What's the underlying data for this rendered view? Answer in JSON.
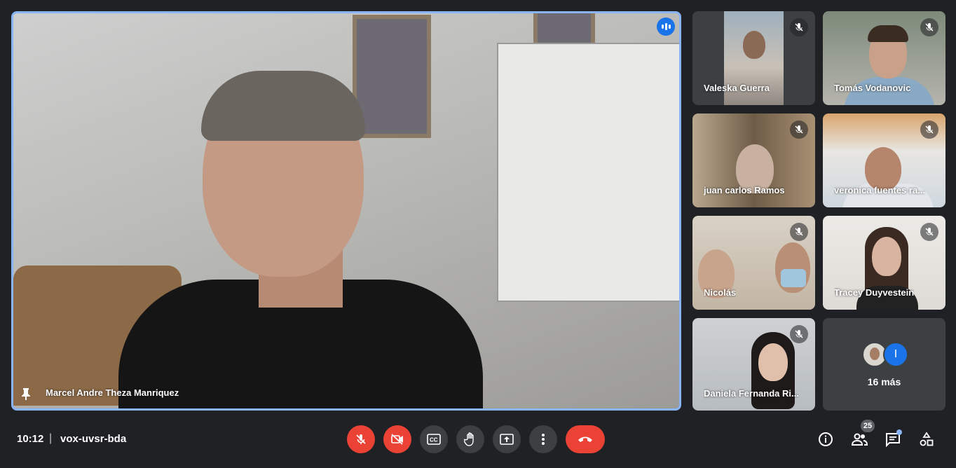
{
  "main_speaker": {
    "name": "Marcel Andre Theza Manriquez"
  },
  "participants": [
    {
      "name": "Valeska Guerra"
    },
    {
      "name": "Tomás Vodanovic"
    },
    {
      "name": "juan carlos Ramos"
    },
    {
      "name": "veronica fuentes ra..."
    },
    {
      "name": "Nicolás"
    },
    {
      "name": "Tracey Duyvestein"
    },
    {
      "name": "Daniela Fernanda Ri..."
    }
  ],
  "more_tile": {
    "label": "16 más",
    "avatar_letter": "I"
  },
  "footer": {
    "time": "10:12",
    "separator": "|",
    "meeting_code": "vox-uvsr-bda",
    "participants_count": "25"
  },
  "icons": [
    "pin-icon",
    "speaking-indicator-icon",
    "mic-off-icon",
    "camera-off-icon",
    "captions-icon",
    "raise-hand-icon",
    "present-icon",
    "more-options-icon",
    "end-call-icon",
    "info-icon",
    "people-icon",
    "chat-icon",
    "activities-icon"
  ],
  "colors": {
    "background": "#202124",
    "accent_border": "#8ab4f8",
    "red": "#ea4335",
    "control_grey": "#3c4043",
    "chat_dot": "#8ab4f8",
    "avatar_blue": "#1a73e8"
  }
}
